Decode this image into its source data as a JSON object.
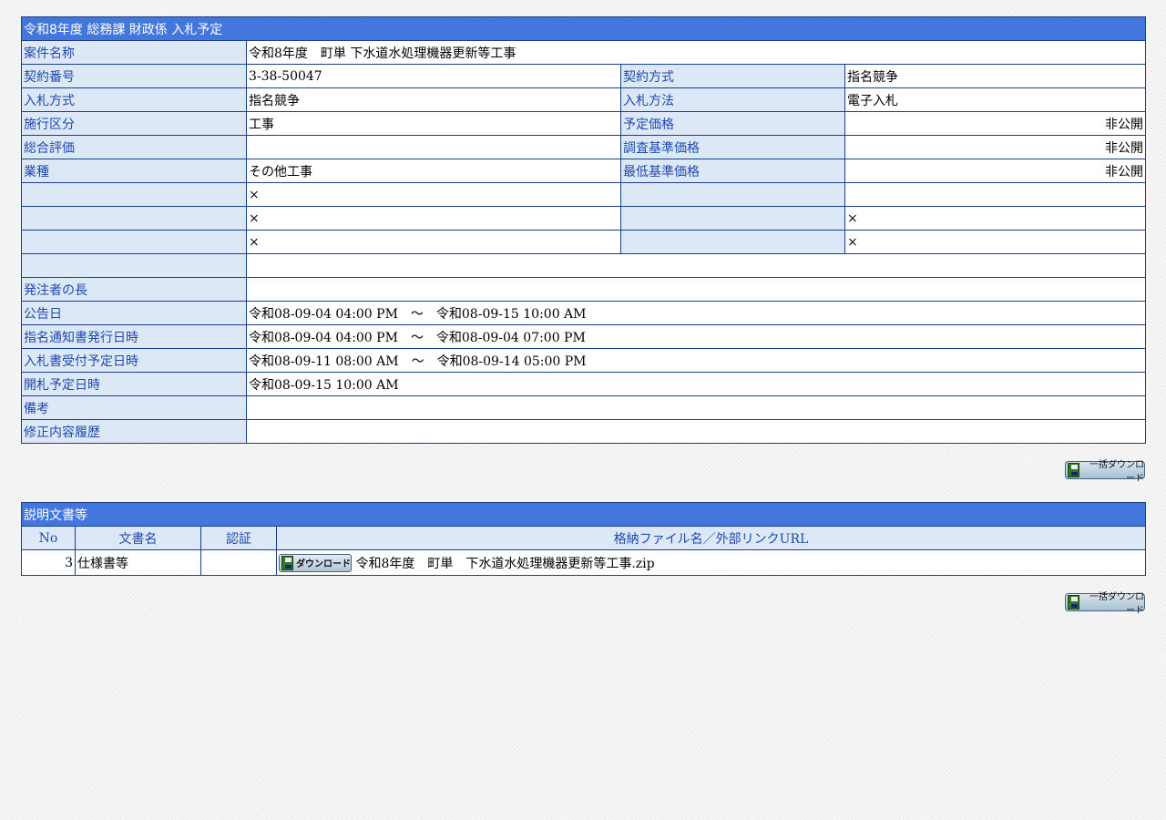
{
  "main": {
    "title": "令和8年度 総務課 財政係 入札予定",
    "project_name_label": "案件名称",
    "project_name": "令和8年度　町単 下水道水処理機器更新等工事",
    "contract_no_label": "契約番号",
    "contract_no": "3-38-50047",
    "contract_method_label": "契約方式",
    "contract_method": "指名競争",
    "bid_type_label": "入札方式",
    "bid_type": "指名競争",
    "bid_method_label": "入札方法",
    "bid_method": "電子入札",
    "work_category_label": "施行区分",
    "work_category": "工事",
    "planned_price_label": "予定価格",
    "planned_price": "非公開",
    "overall_eval_label": "総合評価",
    "overall_eval": "",
    "survey_price_label": "調査基準価格",
    "survey_price": "非公開",
    "industry_label": "業種",
    "industry": "その他工事",
    "min_price_label": "最低基準価格",
    "min_price": "非公開",
    "cross": "×",
    "orderer_label": "発注者の長",
    "orderer": "",
    "notice_date_label": "公告日",
    "notice_date": "令和08-09-04 04:00 PM　～　令和08-09-15 10:00 AM",
    "nomination_label": "指名通知書発行日時",
    "nomination": "令和08-09-04 04:00 PM　～　令和08-09-04 07:00 PM",
    "bid_receipt_label": "入札書受付予定日時",
    "bid_receipt": "令和08-09-11 08:00 AM　～　令和08-09-14 05:00 PM",
    "opening_label": "開札予定日時",
    "opening": "令和08-09-15 10:00 AM",
    "remarks_label": "備考",
    "remarks": "",
    "history_label": "修正内容履歴",
    "history": ""
  },
  "bulk_download_label": "一括ダウンロード",
  "docs": {
    "title": "説明文書等",
    "headers": [
      "No",
      "文書名",
      "認証",
      "格納ファイル名／外部リンクURL"
    ],
    "rows": [
      {
        "no": "3",
        "name": "仕様書等",
        "auth": "",
        "download_label": "ダウンロード",
        "file": "令和8年度　町単　下水道水処理機器更新等工事.zip"
      }
    ]
  }
}
